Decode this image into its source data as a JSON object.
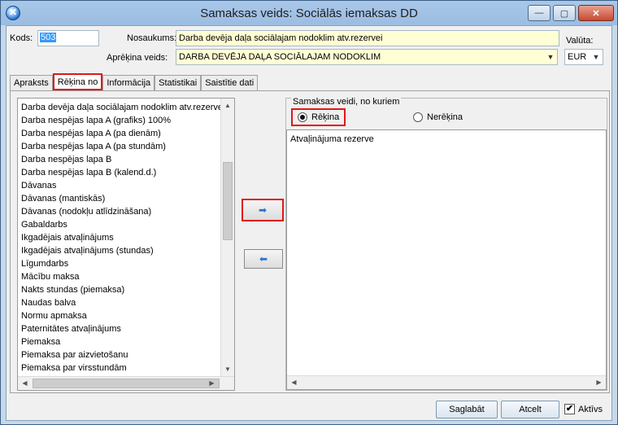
{
  "window": {
    "title": "Samaksas veids: Sociālās iemaksas DD",
    "min_glyph": "—",
    "max_glyph": "▢",
    "close_glyph": "✕"
  },
  "form": {
    "kods_label": "Kods:",
    "kods_value": "503",
    "nosaukums_label": "Nosaukums:",
    "nosaukums_value": "Darba devēja daļa sociālajam nodoklim atv.rezervei",
    "aprekina_label": "Aprēķina veids:",
    "aprekina_value": "DARBA DEVĒJA DAĻA SOCIĀLAJAM NODOKLIM",
    "valuta_label": "Valūta:",
    "valuta_value": "EUR"
  },
  "tabs": [
    {
      "label": "Apraksts"
    },
    {
      "label": "Rēķina no"
    },
    {
      "label": "Informācija"
    },
    {
      "label": "Statistikai"
    },
    {
      "label": "Saistītie dati"
    }
  ],
  "left_list": {
    "items": [
      "Darba devēja daļa sociālajam nodoklim atv.rezervei",
      "Darba nespējas lapa  A (grafiks) 100%",
      "Darba nespējas lapa  A (pa dienām)",
      "Darba nespējas lapa  A (pa stundām)",
      "Darba nespējas lapa  B",
      "Darba nespējas lapa  B (kalend.d.)",
      "Dāvanas",
      "Dāvanas (mantiskās)",
      "Dāvanas (nodokļu atlīdzināšana)",
      "Gabaldarbs",
      "Ikgadējais atvaļinājums",
      "Ikgadējais atvaļinājums (stundas)",
      "Līgumdarbs",
      "Mācību maksa",
      "Nakts stundas (piemaksa)",
      "Naudas balva",
      "Normu apmaksa",
      "Paternitātes atvaļinājums",
      "Piemaksa",
      "Piemaksa par aizvietošanu",
      "Piemaksa par virsstundām"
    ]
  },
  "arrows": {
    "add": "➡",
    "remove": "⬅"
  },
  "right_group": {
    "title": "Samaksas veidi, no kuriem",
    "radio_on": "Rēķina",
    "radio_off": "Nerēķina",
    "items": [
      "Atvaļinājuma rezerve"
    ]
  },
  "footer": {
    "save": "Saglabāt",
    "cancel": "Atcelt",
    "active_label": "Aktīvs",
    "active_checked": "✔"
  }
}
